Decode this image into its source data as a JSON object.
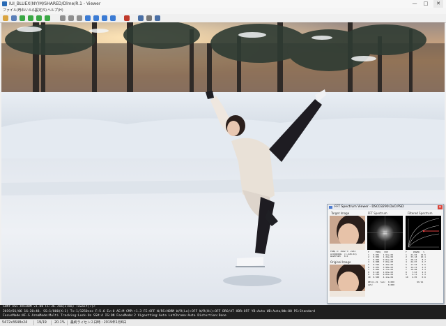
{
  "window": {
    "title": "IUI_BLUEX(NY)M/SHARED/Dlme/R.1 - Viewer",
    "min_glyph": "—",
    "max_glyph": "□",
    "close_glyph": "✕"
  },
  "menu": [
    "ファイル(F)",
    "うねいル(L)",
    "設定(S)",
    "ヘルプ(H)"
  ],
  "toolbar": {
    "buttons": [
      {
        "name": "open-folder-icon",
        "color": "#d9a441"
      },
      {
        "name": "save-icon",
        "color": "#5b7fb8"
      },
      {
        "name": "prev-icon",
        "color": "#3aa845"
      },
      {
        "name": "next-icon",
        "color": "#3aa845"
      },
      {
        "name": "first-icon",
        "color": "#3aa845"
      },
      {
        "name": "last-icon",
        "color": "#3aa845"
      },
      {
        "name": "zoom-in-icon",
        "color": "#8f8f8f"
      },
      {
        "name": "zoom-out-icon",
        "color": "#8f8f8f"
      },
      {
        "name": "fit-icon",
        "color": "#8f8f8f"
      },
      {
        "name": "rotate-left-icon",
        "color": "#3b7bd4"
      },
      {
        "name": "rotate-right-icon",
        "color": "#3b7bd4"
      },
      {
        "name": "flip-icon",
        "color": "#3b7bd4"
      },
      {
        "name": "refresh-icon",
        "color": "#3b7bd4"
      },
      {
        "name": "stop-icon",
        "color": "#c0392b"
      },
      {
        "name": "info-icon",
        "color": "#4a6fa5"
      },
      {
        "name": "settings-icon",
        "color": "#777777"
      },
      {
        "name": "help-icon",
        "color": "#4a6fa5"
      }
    ]
  },
  "info": {
    "line1": "SONY DSC-RX100M  v1.00  FL:36.7mm(37mm)  Tewait(7)c",
    "line2": "2019/01/06 16:20:48.   SS:1/800(X:1)   Tv:1/1250sec  F:5.6   Ev:0    AE:M   CMP:+1.3   FE:OFF   W/RS:NORM  W/R(Lo):OFF  W/R(Hi):OFF  DRO/AT  HDR:OFF   YB:Auto  WB:Auto/Wb:00  PS:Standard",
    "line3": "FocusMode:AF-S  AreaMode:Multi  Tracking:Lock-On  SS#:4  IS:ON  FaceMode:2  Vignetting:Auto  LatChroma:Auto  Distortion:Done"
  },
  "status": {
    "dims": "5472x3648x24",
    "page": "19/19",
    "zoom": "20.1%",
    "date": "最終ライセンス日時 : 2019年1月6日"
  },
  "fft": {
    "title": "FFT Spectrum Viewer - DSC03290.DxO.PSD",
    "target_label": "Target Image",
    "spectrum_label": "FFT Spectrum",
    "filtered_label": "Filtered Spectrum",
    "original_label": "Original Image",
    "readout_text": "FREQ X: 2562 Y: 2234\nACCORDING  (1.228.04)\nWAVEFORM   0.0",
    "col1_text": "F     FREQ   EXP\n1   0.001   1.91e-02\n2   0.002   1.24e-02\n3   0.004   9.81e-03\n4   0.008   7.02e-03\n5   0.016   5.44e-03\n6   0.031   3.98e-03\n7   0.062   2.71e-03\n8   0.125   1.63e-03\n9   0.250   9.02e-04\n10  0.500   4.11e-04\n\nRES(1.21  Sum:  0.000\nAVG:            0.000",
    "col2_text": "F     POWER   %\n1   41.02   12.5\n2   33.18   10.1\n3   28.44    8.7\n4   22.07    6.7\n5   17.93    5.5\n6   14.21    4.3\n7   10.88    3.3\n8    7.63    2.3\n9    4.11    1.3\n10   2.05    0.6\n\n         99.91"
  }
}
